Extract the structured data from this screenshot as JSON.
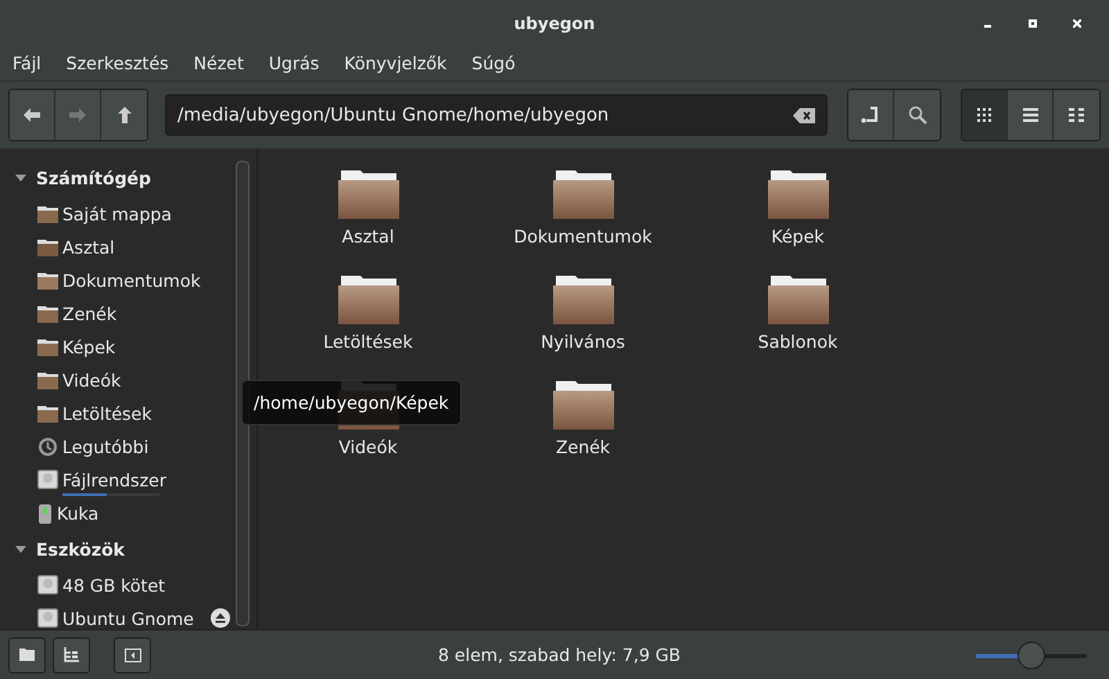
{
  "window": {
    "title": "ubyegon"
  },
  "menu": [
    "Fájl",
    "Szerkesztés",
    "Nézet",
    "Ugrás",
    "Könyvjelzők",
    "Súgó"
  ],
  "location": {
    "value": "/media/ubyegon/Ubuntu Gnome/home/ubyegon"
  },
  "view_buttons": [
    {
      "kind": "icons",
      "selected": true
    },
    {
      "kind": "list",
      "selected": false
    },
    {
      "kind": "compact",
      "selected": false
    }
  ],
  "sidebar": {
    "sections": [
      {
        "title": "Számítógép",
        "expanded": true,
        "items": [
          {
            "label": "Saját mappa",
            "kind": "home"
          },
          {
            "label": "Asztal",
            "kind": "desktop"
          },
          {
            "label": "Dokumentumok",
            "kind": "documents"
          },
          {
            "label": "Zenék",
            "kind": "music"
          },
          {
            "label": "Képek",
            "kind": "pictures"
          },
          {
            "label": "Videók",
            "kind": "videos"
          },
          {
            "label": "Letöltések",
            "kind": "downloads"
          },
          {
            "label": "Legutóbbi",
            "kind": "recent"
          },
          {
            "label": "Fájlrendszer",
            "kind": "drive",
            "level": 0.45
          },
          {
            "label": "Kuka",
            "kind": "trash"
          }
        ]
      },
      {
        "title": "Eszközök",
        "expanded": true,
        "items": [
          {
            "label": "48 GB kötet",
            "kind": "drive"
          },
          {
            "label": "Ubuntu Gnome",
            "kind": "mount"
          }
        ]
      }
    ]
  },
  "folders": [
    "Asztal",
    "Dokumentumok",
    "Képek",
    "Letöltések",
    "Nyilvános",
    "Sablonok",
    "Videók",
    "Zenék"
  ],
  "tooltip": "/home/ubyegon/Képek",
  "status_bar": {
    "text": "8 elem, szabad hely: 7,9 GB",
    "zoom": {
      "level": 0.5
    }
  }
}
